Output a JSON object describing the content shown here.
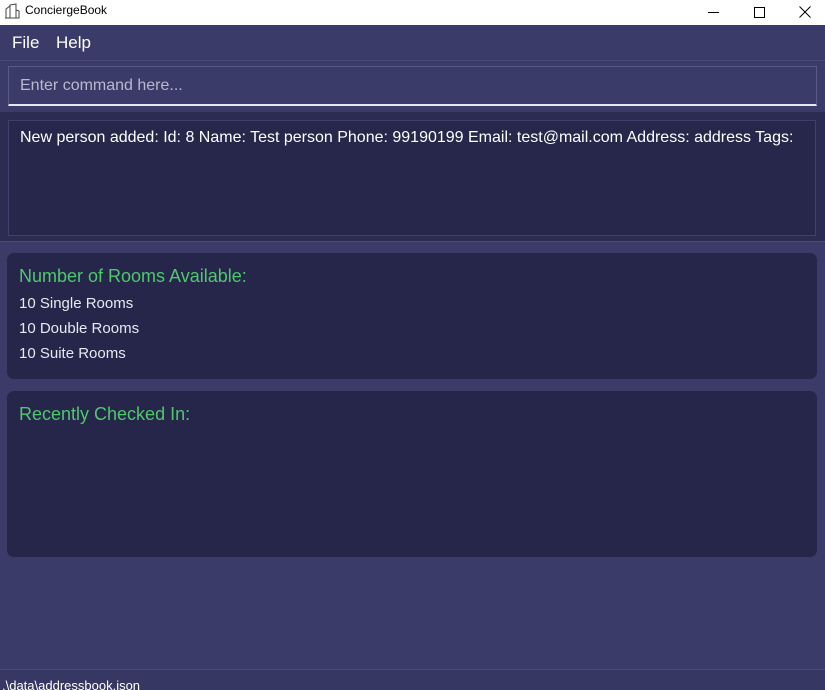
{
  "window": {
    "title": "ConciergeBook",
    "app_icon": "building-icon",
    "controls": [
      "minimize-icon",
      "maximize-icon",
      "close-icon"
    ]
  },
  "menu": {
    "file_label": "File",
    "help_label": "Help"
  },
  "command": {
    "placeholder": "Enter command here...",
    "value": ""
  },
  "result": {
    "message": "New person added: Id: 8 Name: Test person Phone: 99190199 Email: test@mail.com Address: address Tags:"
  },
  "rooms": {
    "heading": "Number of Rooms Available:",
    "lines": [
      "10 Single Rooms",
      "10 Double Rooms",
      "10 Suite Rooms"
    ]
  },
  "recent": {
    "heading": "Recently Checked In:"
  },
  "status": {
    "path": ".\\data\\addressbook.json"
  },
  "colors": {
    "background": "#3b3b6a",
    "panel": "#25264a",
    "accent_green": "#4fc86c"
  }
}
